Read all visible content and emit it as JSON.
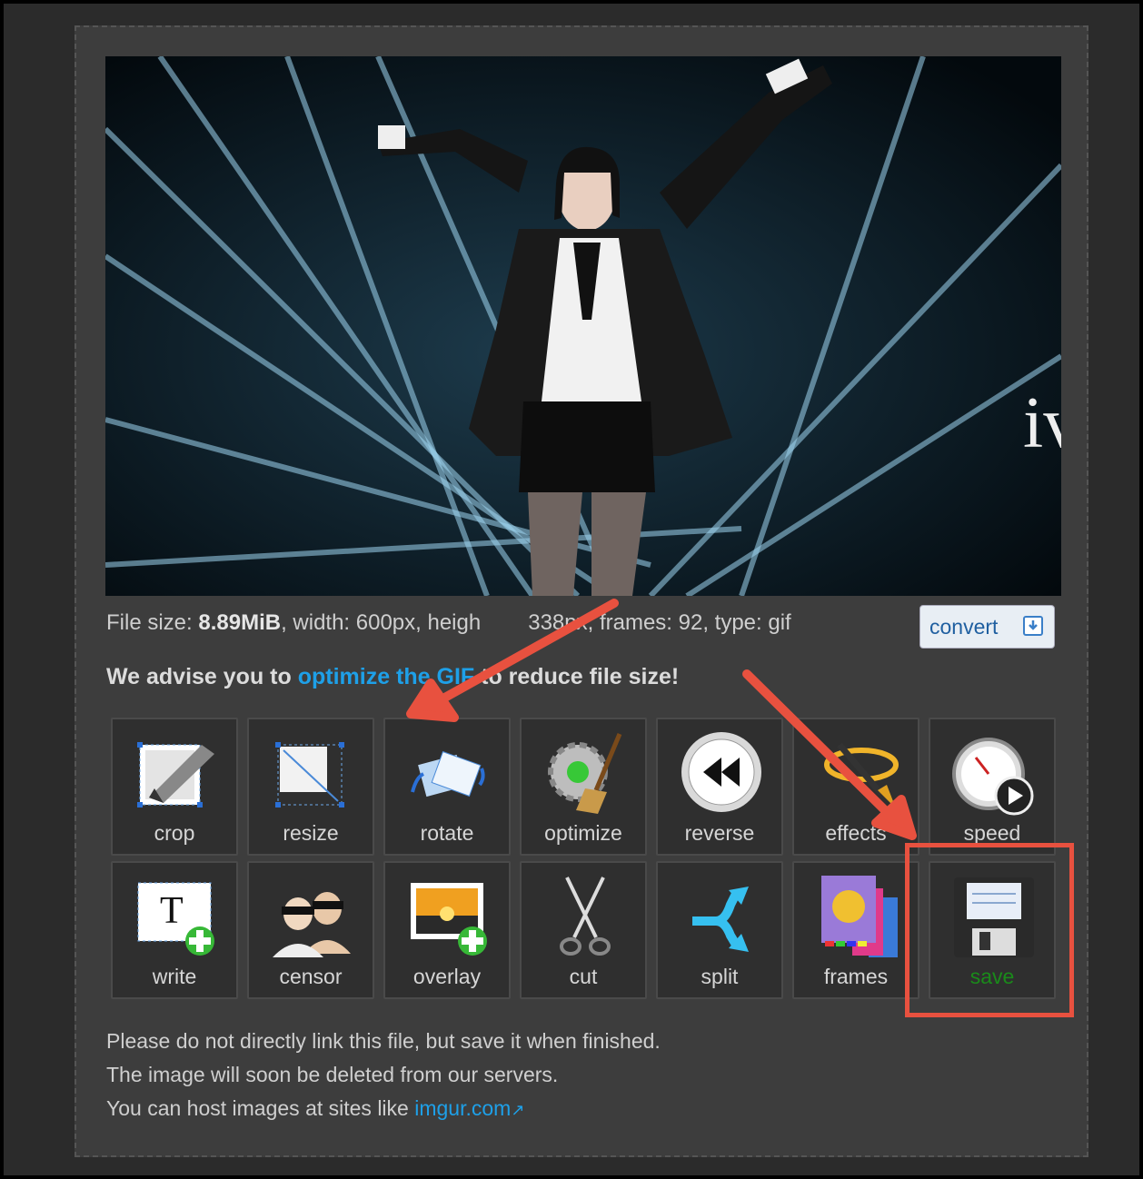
{
  "file_info": {
    "label_prefix": "File size: ",
    "size": "8.89MiB",
    "rest": ", width: 600px, heigh",
    "rest2": "338px, frames: 92, type: gif"
  },
  "convert": {
    "label": "convert",
    "icon": "download-icon"
  },
  "advise": {
    "prefix": "We advise you to ",
    "link": "optimize the GIF",
    "suffix": " to reduce file size!"
  },
  "tools": [
    {
      "label": "crop",
      "icon": "crop-icon"
    },
    {
      "label": "resize",
      "icon": "resize-icon"
    },
    {
      "label": "rotate",
      "icon": "rotate-icon"
    },
    {
      "label": "optimize",
      "icon": "optimize-icon"
    },
    {
      "label": "reverse",
      "icon": "reverse-icon"
    },
    {
      "label": "effects",
      "icon": "effects-icon"
    },
    {
      "label": "speed",
      "icon": "speed-icon"
    },
    {
      "label": "write",
      "icon": "write-icon"
    },
    {
      "label": "censor",
      "icon": "censor-icon"
    },
    {
      "label": "overlay",
      "icon": "overlay-icon"
    },
    {
      "label": "cut",
      "icon": "scissors-icon"
    },
    {
      "label": "split",
      "icon": "split-icon"
    },
    {
      "label": "frames",
      "icon": "frames-icon"
    },
    {
      "label": "save",
      "icon": "floppy-disk-icon"
    }
  ],
  "notes": {
    "line1": "Please do not directly link this file, but save it when finished.",
    "line2": "The image will soon be deleted from our servers.",
    "line3_prefix": "You can host images at sites like ",
    "line3_link": "imgur.com"
  },
  "colors": {
    "accent_link": "#1ea0e8",
    "highlight": "#e8513f",
    "save_label": "#1a8a1a"
  }
}
